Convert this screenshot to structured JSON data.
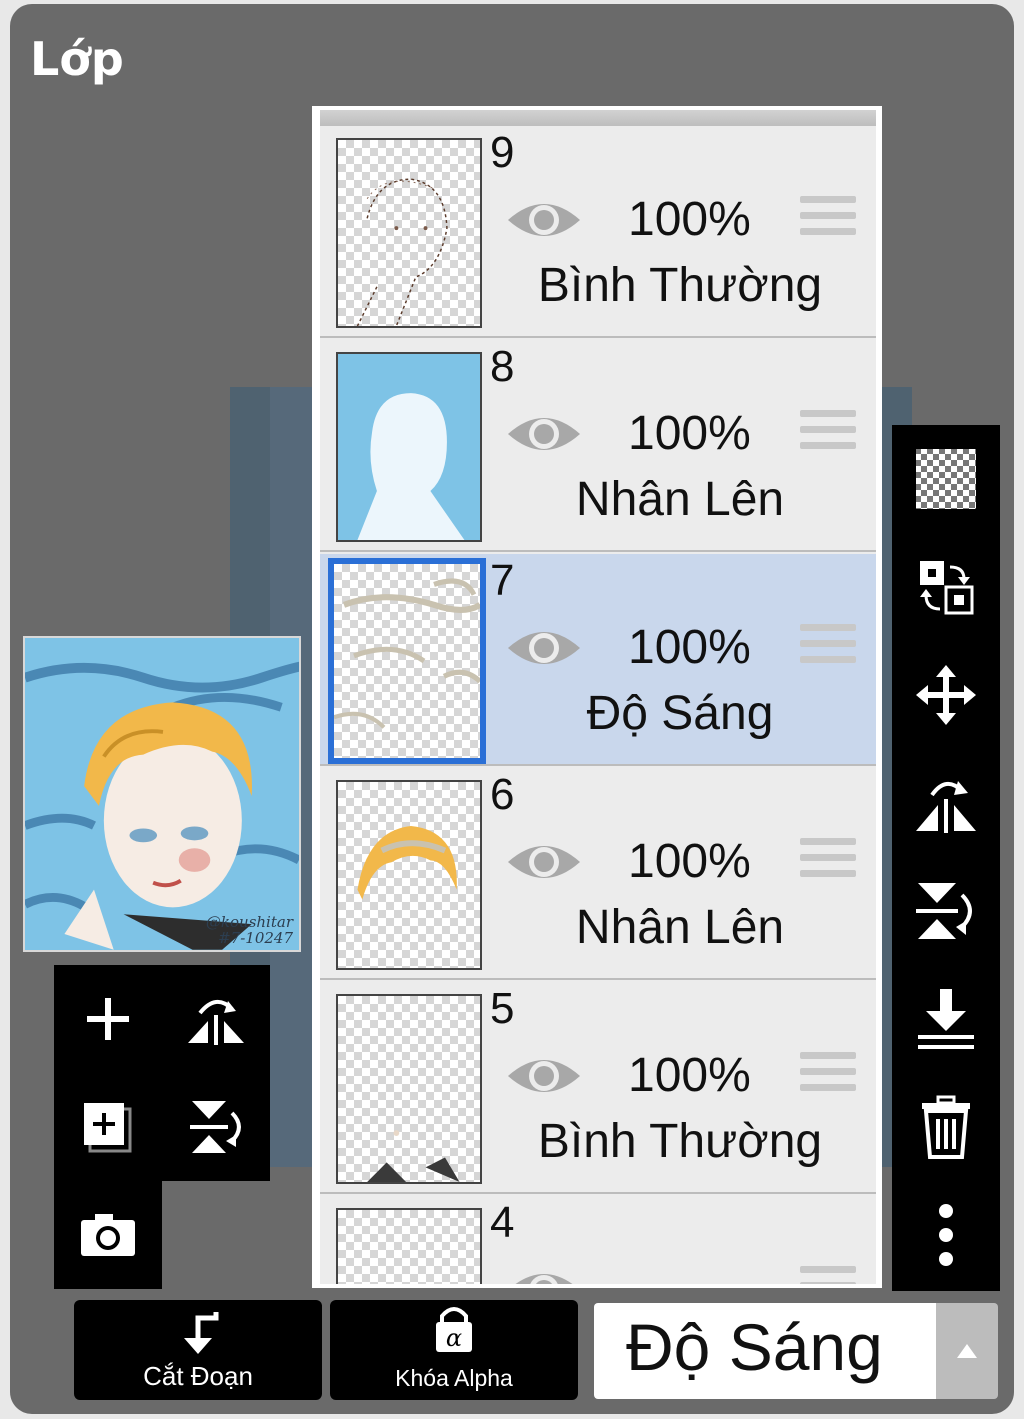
{
  "panel": {
    "title": "Lớp"
  },
  "preview": {
    "signature_line1": "@koushitar",
    "signature_line2": "#7-10247"
  },
  "layers": [
    {
      "number": "9",
      "opacity": "100%",
      "blend": "Bình Thường",
      "visible": true,
      "selected": false
    },
    {
      "number": "8",
      "opacity": "100%",
      "blend": "Nhân Lên",
      "visible": true,
      "selected": false
    },
    {
      "number": "7",
      "opacity": "100%",
      "blend": "Độ Sáng",
      "visible": true,
      "selected": true
    },
    {
      "number": "6",
      "opacity": "100%",
      "blend": "Nhân Lên",
      "visible": true,
      "selected": false
    },
    {
      "number": "5",
      "opacity": "100%",
      "blend": "Bình Thường",
      "visible": true,
      "selected": false
    },
    {
      "number": "4",
      "opacity": "",
      "blend": "",
      "visible": true,
      "selected": false
    }
  ],
  "left_tools": [
    "add-layer-icon",
    "flip-horizontal-icon",
    "add-copy-layer-icon",
    "flip-vertical-icon",
    "camera-icon"
  ],
  "right_tools": [
    "transparency-icon",
    "swap-layer-icon",
    "move-icon",
    "flip-horizontal-icon",
    "flip-vertical-icon",
    "merge-down-icon",
    "trash-icon",
    "more-icon"
  ],
  "bottom": {
    "clip_label": "Cắt Đoạn",
    "alpha_label": "Khóa Alpha",
    "blend_mode": "Độ Sáng"
  },
  "colors": {
    "selected_bg": "#c9d7ec",
    "selected_border": "#2a6fd6",
    "panel_bg": "#6a6a6a",
    "sky": "#7ec3e6"
  }
}
